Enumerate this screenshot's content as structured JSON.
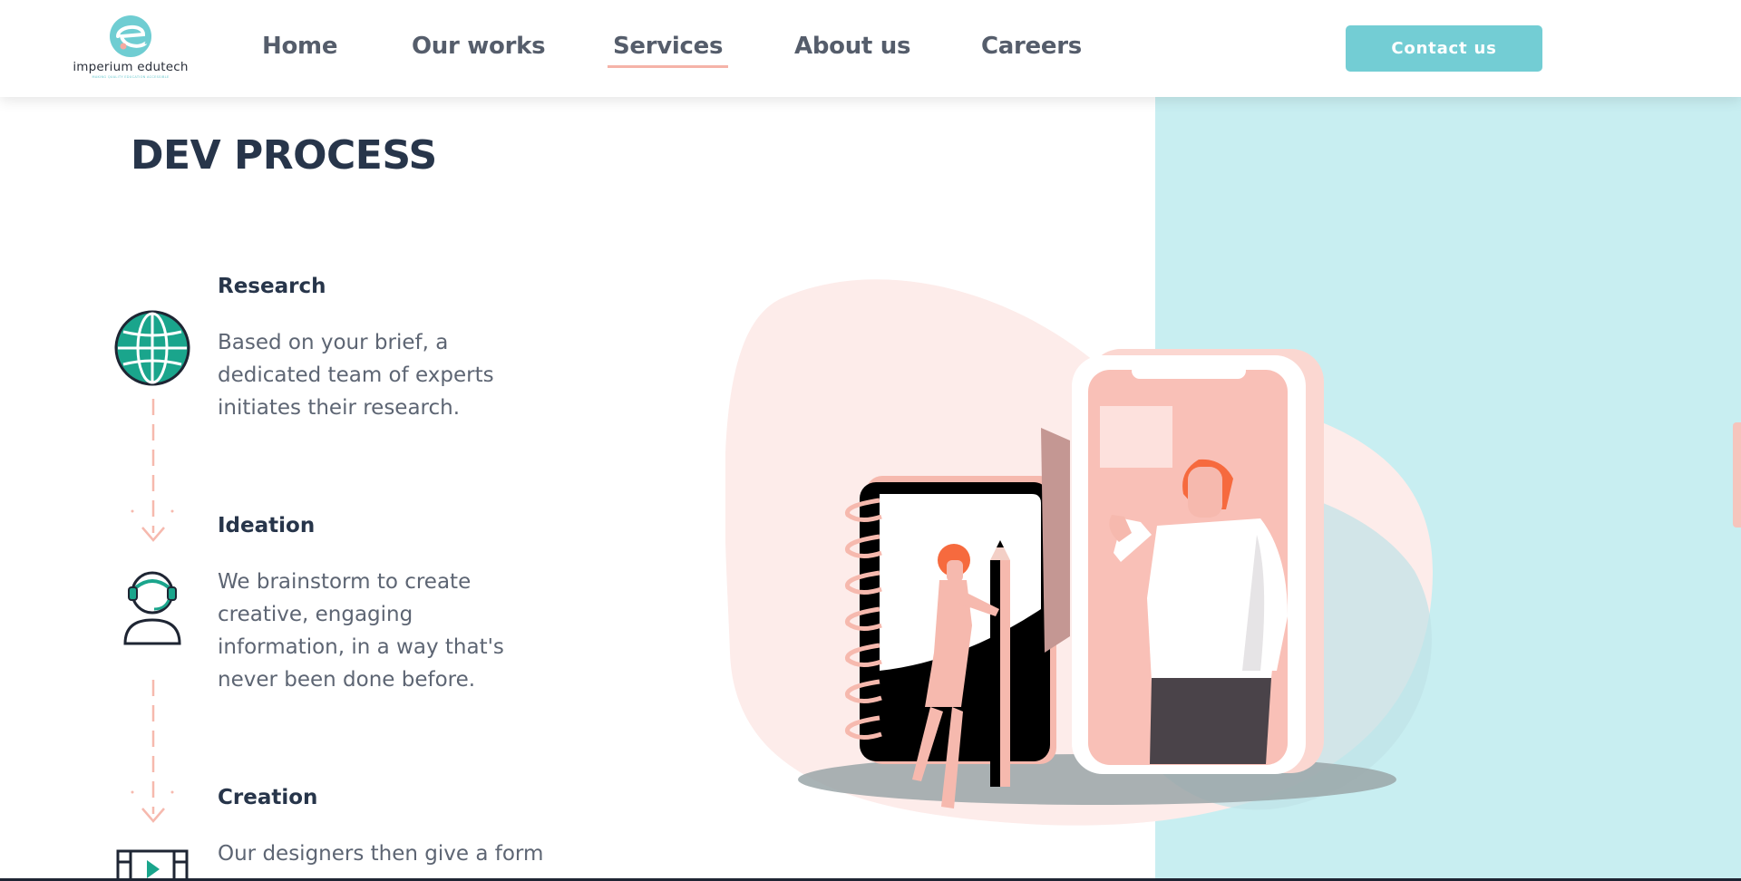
{
  "header": {
    "logo": {
      "word": "imperium edutech",
      "tagline": "MAKING QUALITY EDUCATION ACCESSIBLE"
    },
    "nav": [
      {
        "label": "Home"
      },
      {
        "label": "Our works"
      },
      {
        "label": "Services",
        "active": true
      },
      {
        "label": "About us"
      },
      {
        "label": "Careers"
      }
    ],
    "contact_label": "Contact us"
  },
  "section": {
    "title": "DEV PROCESS",
    "steps": [
      {
        "title": "Research",
        "desc": "Based on your brief, a dedicated team of experts initiates their research.",
        "icon": "globe-icon"
      },
      {
        "title": "Ideation",
        "desc": "We brainstorm to create creative, engaging information, in a way that's never been done before.",
        "icon": "person-headset-icon"
      },
      {
        "title": "Creation",
        "desc": "Our designers then give a form",
        "icon": "film-play-icon"
      }
    ]
  },
  "colors": {
    "accent_teal": "#73cdd4",
    "panel_teal": "#c8eef1",
    "nav_underline": "#f5b3a8",
    "heading": "#27354a",
    "body_text": "#5d6573",
    "icon_green": "#1aa58c",
    "peach": "#f9c0b7"
  }
}
